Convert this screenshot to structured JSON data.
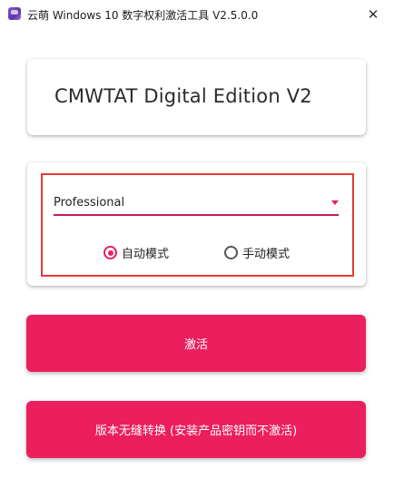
{
  "window": {
    "title": "云萌 Windows 10 数字权利激活工具 V2.5.0.0",
    "close_glyph": "✕"
  },
  "header": {
    "title": "CMWTAT Digital Edition V2"
  },
  "options": {
    "edition": {
      "selected": "Professional"
    },
    "mode": {
      "auto_label": "自动模式",
      "manual_label": "手动模式",
      "selected": "auto"
    }
  },
  "buttons": {
    "activate_label": "激活",
    "convert_label": "版本无缝转换 (安装产品密钥而不激活)"
  },
  "colors": {
    "accent": "#e91e63",
    "button": "#ec1f5e",
    "highlight": "#e53935",
    "icon": "#7e57c2"
  },
  "icons": {
    "app": "app-icon",
    "close": "close-icon",
    "dropdown": "chevron-down-icon"
  }
}
